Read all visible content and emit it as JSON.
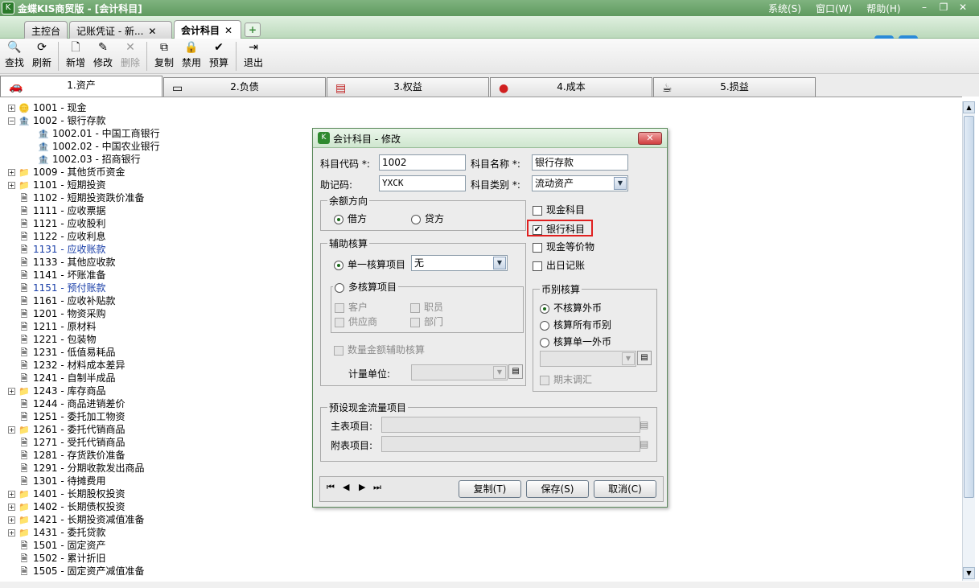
{
  "window": {
    "title": "金蝶KIS商贸版 - [会计科目]",
    "menus": [
      "系统(S)",
      "窗口(W)",
      "帮助(H)"
    ]
  },
  "tabs": [
    {
      "label": "主控台"
    },
    {
      "label": "记账凭证 - 新..."
    },
    {
      "label": "会计科目"
    }
  ],
  "toolbar": {
    "find": "查找",
    "refresh": "刷新",
    "new": "新增",
    "modify": "修改",
    "delete": "删除",
    "copy": "复制",
    "disable": "禁用",
    "preview": "预算",
    "exit": "退出"
  },
  "category_tabs": [
    {
      "label": "1.资产"
    },
    {
      "label": "2.负债"
    },
    {
      "label": "3.权益"
    },
    {
      "label": "4.成本"
    },
    {
      "label": "5.损益"
    }
  ],
  "tree": [
    {
      "code": "1001",
      "name": "现金",
      "expand": true,
      "icon": "coins-icon",
      "level": 0
    },
    {
      "code": "1002",
      "name": "银行存款",
      "expand": "minus",
      "icon": "bank-icon",
      "level": 0
    },
    {
      "code": "1002.01",
      "name": "中国工商银行",
      "icon": "bank-icon",
      "level": 1
    },
    {
      "code": "1002.02",
      "name": "中国农业银行",
      "icon": "bank-icon",
      "level": 1
    },
    {
      "code": "1002.03",
      "name": "招商银行",
      "icon": "bank-icon",
      "level": 1
    },
    {
      "code": "1009",
      "name": "其他货币资金",
      "expand": true,
      "icon": "folder-icon",
      "level": 0
    },
    {
      "code": "1101",
      "name": "短期投资",
      "expand": true,
      "icon": "folder-icon",
      "level": 0
    },
    {
      "code": "1102",
      "name": "短期投资跌价准备",
      "icon": "doc-icon",
      "level": 0
    },
    {
      "code": "1111",
      "name": "应收票据",
      "icon": "doc-icon",
      "level": 0
    },
    {
      "code": "1121",
      "name": "应收股利",
      "icon": "doc-icon",
      "level": 0
    },
    {
      "code": "1122",
      "name": "应收利息",
      "icon": "doc-icon",
      "level": 0
    },
    {
      "code": "1131",
      "name": "应收账款",
      "icon": "doc-icon",
      "level": 0,
      "blue": true
    },
    {
      "code": "1133",
      "name": "其他应收款",
      "icon": "doc-icon",
      "level": 0
    },
    {
      "code": "1141",
      "name": "坏账准备",
      "icon": "doc-icon",
      "level": 0
    },
    {
      "code": "1151",
      "name": "预付账款",
      "icon": "doc-icon",
      "level": 0,
      "blue": true
    },
    {
      "code": "1161",
      "name": "应收补贴款",
      "icon": "doc-icon",
      "level": 0
    },
    {
      "code": "1201",
      "name": "物资采购",
      "icon": "doc-icon",
      "level": 0
    },
    {
      "code": "1211",
      "name": "原材料",
      "icon": "doc-icon",
      "level": 0
    },
    {
      "code": "1221",
      "name": "包装物",
      "icon": "doc-icon",
      "level": 0
    },
    {
      "code": "1231",
      "name": "低值易耗品",
      "icon": "doc-icon",
      "level": 0
    },
    {
      "code": "1232",
      "name": "材料成本差异",
      "icon": "doc-icon",
      "level": 0
    },
    {
      "code": "1241",
      "name": "自制半成品",
      "icon": "doc-icon",
      "level": 0
    },
    {
      "code": "1243",
      "name": "库存商品",
      "expand": true,
      "icon": "folder-icon",
      "level": 0
    },
    {
      "code": "1244",
      "name": "商品进销差价",
      "icon": "doc-icon",
      "level": 0
    },
    {
      "code": "1251",
      "name": "委托加工物资",
      "icon": "doc-icon",
      "level": 0
    },
    {
      "code": "1261",
      "name": "委托代销商品",
      "expand": true,
      "icon": "folder-icon",
      "level": 0
    },
    {
      "code": "1271",
      "name": "受托代销商品",
      "icon": "doc-icon",
      "level": 0
    },
    {
      "code": "1281",
      "name": "存货跌价准备",
      "icon": "doc-icon",
      "level": 0
    },
    {
      "code": "1291",
      "name": "分期收款发出商品",
      "icon": "doc-icon",
      "level": 0
    },
    {
      "code": "1301",
      "name": "待摊费用",
      "icon": "doc-icon",
      "level": 0
    },
    {
      "code": "1401",
      "name": "长期股权投资",
      "expand": true,
      "icon": "folder-icon",
      "level": 0
    },
    {
      "code": "1402",
      "name": "长期债权投资",
      "expand": true,
      "icon": "folder-icon",
      "level": 0
    },
    {
      "code": "1421",
      "name": "长期投资减值准备",
      "expand": true,
      "icon": "folder-icon",
      "level": 0
    },
    {
      "code": "1431",
      "name": "委托贷款",
      "expand": true,
      "icon": "folder-icon",
      "level": 0
    },
    {
      "code": "1501",
      "name": "固定资产",
      "icon": "doc-icon",
      "level": 0
    },
    {
      "code": "1502",
      "name": "累计折旧",
      "icon": "doc-icon",
      "level": 0
    },
    {
      "code": "1505",
      "name": "固定资产减值准备",
      "icon": "doc-icon",
      "level": 0
    }
  ],
  "dialog": {
    "title": "会计科目 - 修改",
    "code_label": "科目代码 *:",
    "code_value": "1002",
    "name_label": "科目名称 *:",
    "name_value": "银行存款",
    "mnemonic_label": "助记码:",
    "mnemonic_value": "YXCK",
    "type_label": "科目类别 *:",
    "type_value": "流动资产",
    "balance_group": "余额方向",
    "debit": "借方",
    "credit": "贷方",
    "cash_subject": "现金科目",
    "bank_subject": "银行科目",
    "cash_equiv": "现金等价物",
    "daily_journal": "出日记账",
    "aux_group": "辅助核算",
    "single_item": "单一核算项目",
    "single_value": "无",
    "multi_item": "多核算项目",
    "customer": "客户",
    "employee": "职员",
    "supplier": "供应商",
    "department": "部门",
    "qty_aux": "数量金额辅助核算",
    "unit_label": "计量单位:",
    "currency_group": "币别核算",
    "no_foreign": "不核算外币",
    "all_currency": "核算所有币别",
    "single_foreign": "核算单一外币",
    "period_adjust": "期末调汇",
    "cashflow_group": "预设现金流量项目",
    "main_item": "主表项目:",
    "sub_item": "附表项目:",
    "copy_btn": "复制(T)",
    "save_btn": "保存(S)",
    "cancel_btn": "取消(C)"
  },
  "colors": {
    "accent": "#5f9a5f",
    "highlight": "#e02020",
    "link": "#1a3fa8"
  }
}
